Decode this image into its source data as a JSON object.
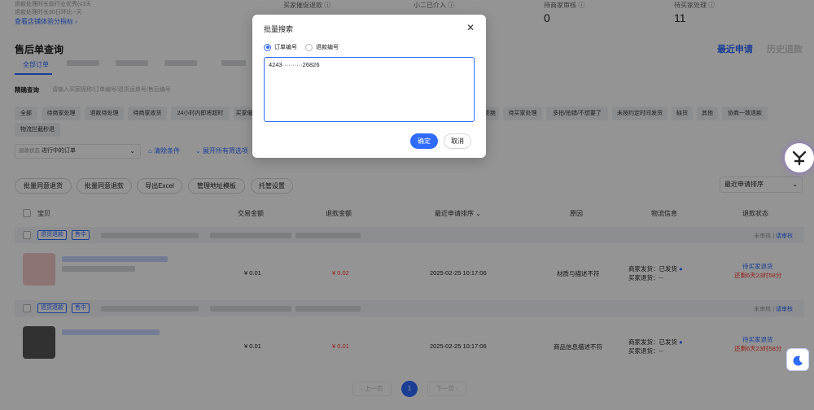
{
  "top": {
    "tip1": "退款处理时长前行业优秀(≤3天",
    "tip2": "退款处理时长30日环比--天",
    "link": "查看店铺体验分指标 ›",
    "stats": [
      {
        "label": "买家催促退款 ⓘ",
        "value": ""
      },
      {
        "label": "小二已介入 ⓘ",
        "value": ""
      },
      {
        "label": "待商家审核 ⓘ",
        "value": "0"
      },
      {
        "label": "待买家处理 ⓘ",
        "value": "11"
      }
    ]
  },
  "section": {
    "title": "售后单查询",
    "right_tab_active": "最近申请",
    "right_tab_dim": "历史退款"
  },
  "order_tabs": {
    "active": "全部订单"
  },
  "search": {
    "label": "精确查询",
    "placeholder": "请输入买家昵称/订单编号/退货运单号/售后编号"
  },
  "chips": [
    "全部",
    "待商家处理",
    "退款待处理",
    "待商家收货",
    "24小时内即将超时",
    "买家催",
    "拒绝",
    "待买家处理",
    "多拍/拍错/不想要了",
    "未按约定时间发货",
    "缺货",
    "其他",
    "协商一致退款",
    "物流拦截秒退"
  ],
  "filter": {
    "prefix": "退款状态",
    "value": "进行中的订单",
    "clear": "清除条件",
    "expand": "展开所有筛选项"
  },
  "actions": [
    "批量同意退货",
    "批量同意退款",
    "导出Excel",
    "管理地址模板",
    "托管设置"
  ],
  "sort": "最近申请排序",
  "table": {
    "headers": [
      "宝贝",
      "交易金额",
      "退款金额",
      "最近申请排序 ⌄",
      "原因",
      "物流信息",
      "退款状态"
    ]
  },
  "orders": [
    {
      "tags": [
        "退货退款",
        "售中"
      ],
      "group_right": "未审核",
      "group_right_link": "请审核",
      "amount": "¥ 0.01",
      "refund": "¥ 0.02",
      "time": "2025-02-25 10:17:06",
      "reason": "材质与描述不符",
      "ship1": "商家发货：已发货",
      "ship2": "买家退货：--",
      "status": "待买家退货",
      "countdown": "还剩6天23时58分"
    },
    {
      "tags": [
        "退货退款",
        "售中"
      ],
      "group_right": "未审核",
      "group_right_link": "请审核",
      "amount": "¥ 0.01",
      "refund": "¥ 0.01",
      "time": "2025-02-25 10:17:06",
      "reason": "商品信息描述不符",
      "ship1": "商家发货：已发货",
      "ship2": "买家退货：--",
      "status": "待买家退货",
      "countdown": "还剩6天23时58分"
    }
  ],
  "pager": {
    "prev": "‹ 上一页",
    "current": "1",
    "next": "下一页 ›"
  },
  "modal": {
    "title": "批量搜索",
    "close": "✕",
    "radio1": "订单编号",
    "radio2": "退款编号",
    "textarea_value": "4243··········26826",
    "ok": "确定",
    "cancel": "取消"
  },
  "colors": {
    "accent": "#2f6bff",
    "danger": "#ff3b30"
  }
}
